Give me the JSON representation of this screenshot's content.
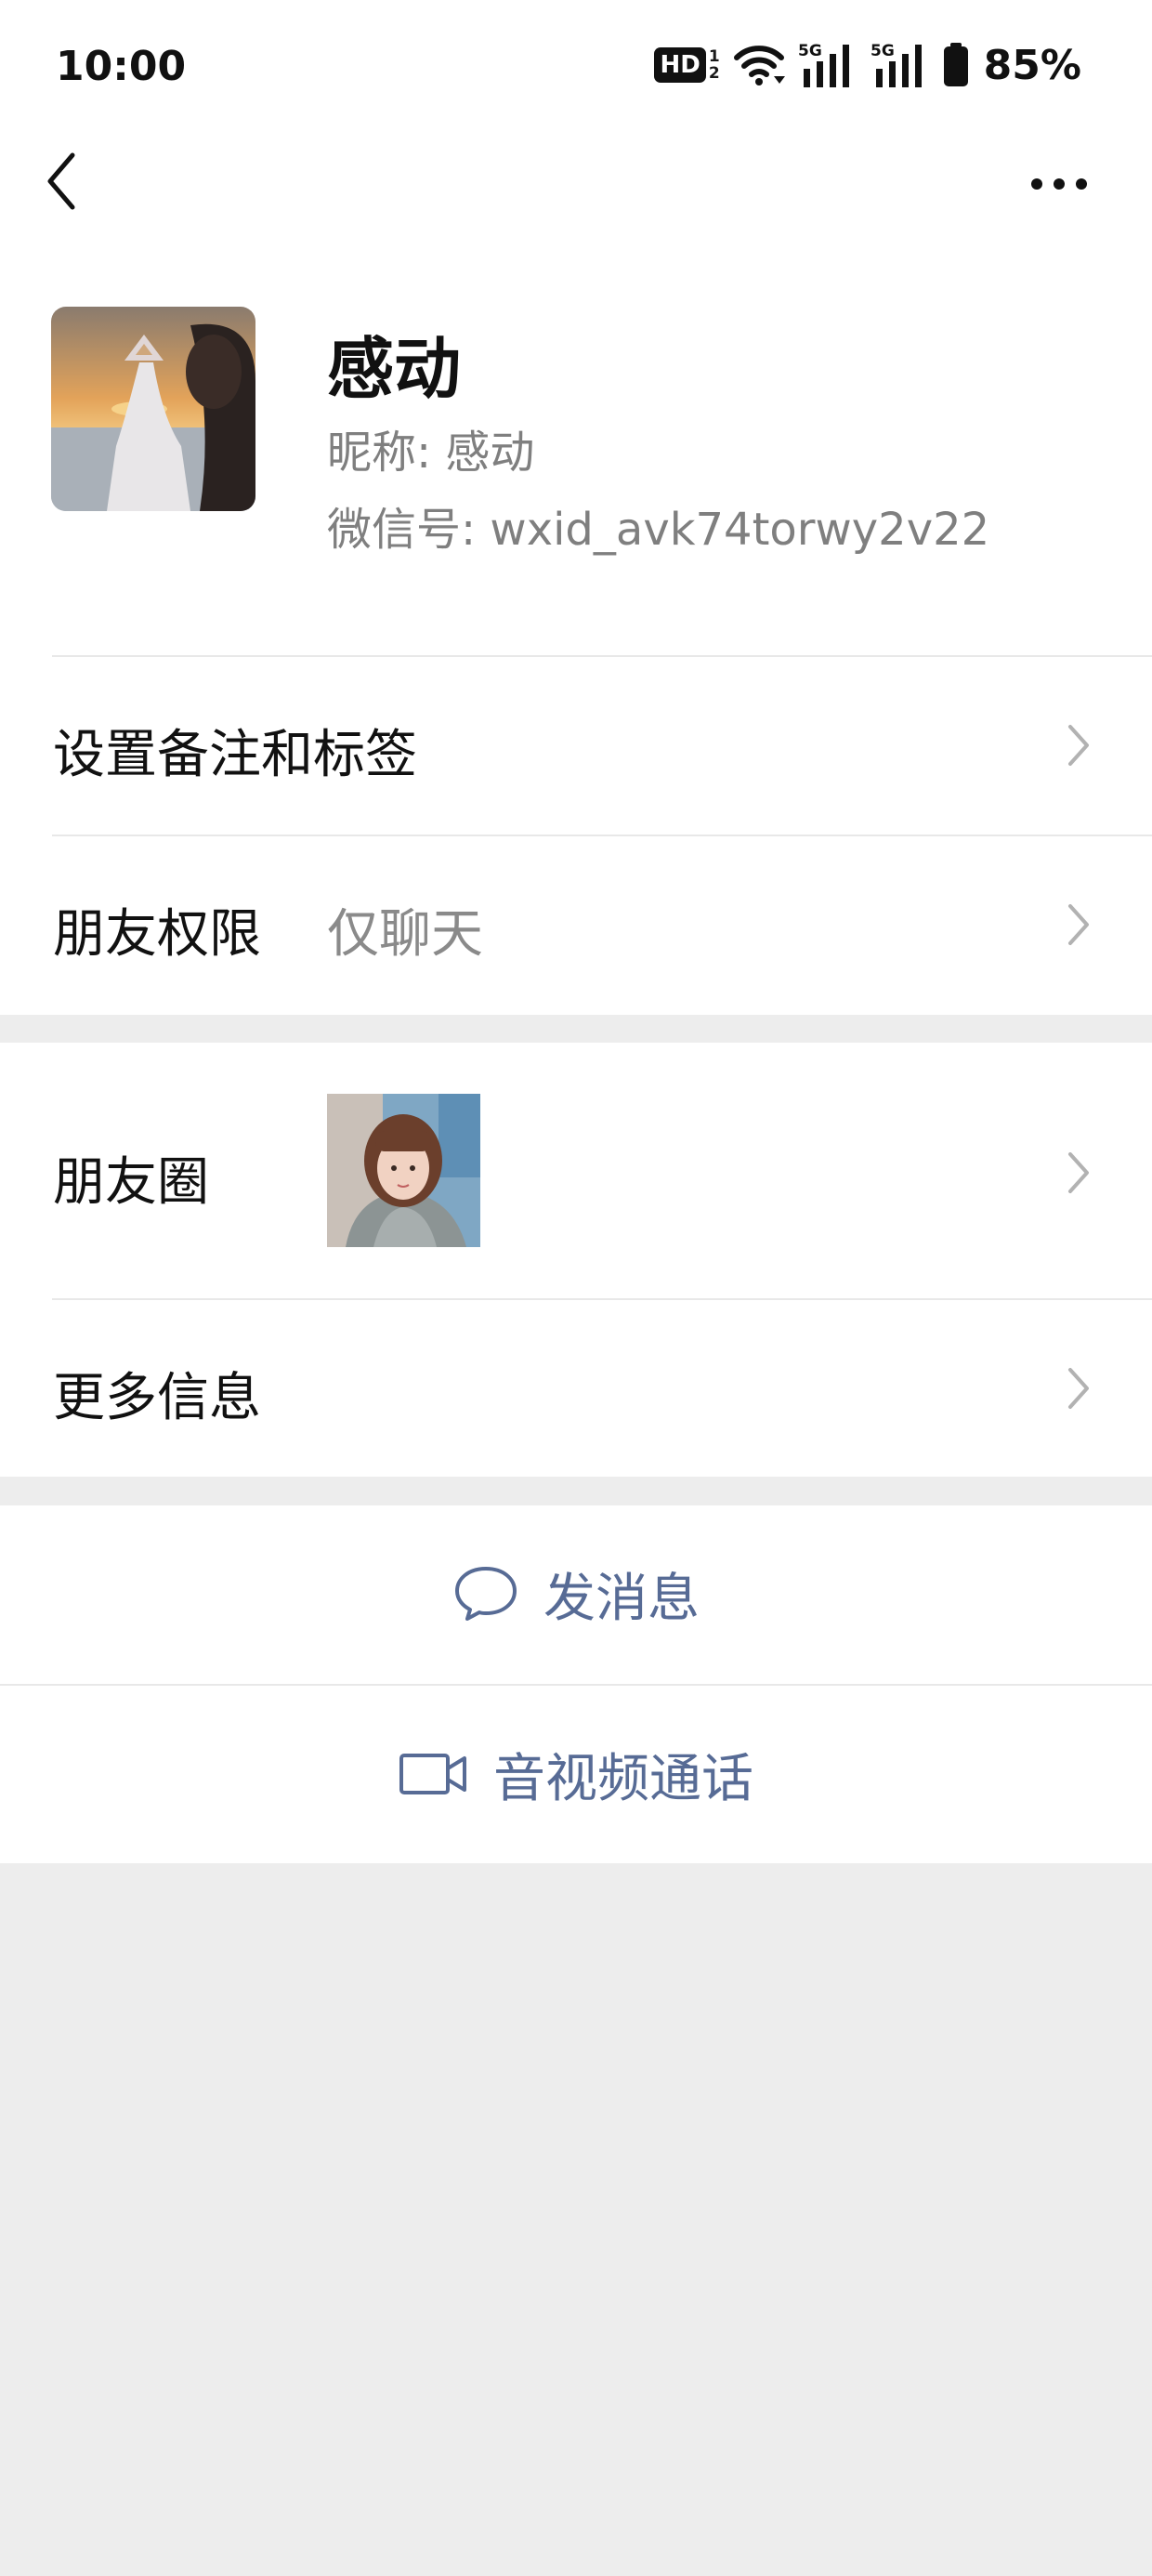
{
  "status_bar": {
    "time": "10:00",
    "hd_label": "HD",
    "hd_sub_top": "1",
    "hd_sub_bottom": "2",
    "net1": "5G",
    "net2": "5G",
    "battery_percent": "85%"
  },
  "nav": {
    "back_icon": "chevron-left-icon",
    "more_icon": "more-dots-icon"
  },
  "profile": {
    "name": "感动",
    "nickname_line": "昵称:  感动",
    "wechat_id_line": "微信号:  wxid_avk74torwy2v22"
  },
  "rows": {
    "remark_tags": "设置备注和标签",
    "permissions_label": "朋友权限",
    "permissions_value": "仅聊天",
    "moments_label": "朋友圈",
    "more_info": "更多信息"
  },
  "actions": {
    "send_message": "发消息",
    "video_call": "音视频通话"
  },
  "colors": {
    "link": "#576b95",
    "background": "#ededed",
    "card": "#ffffff"
  }
}
